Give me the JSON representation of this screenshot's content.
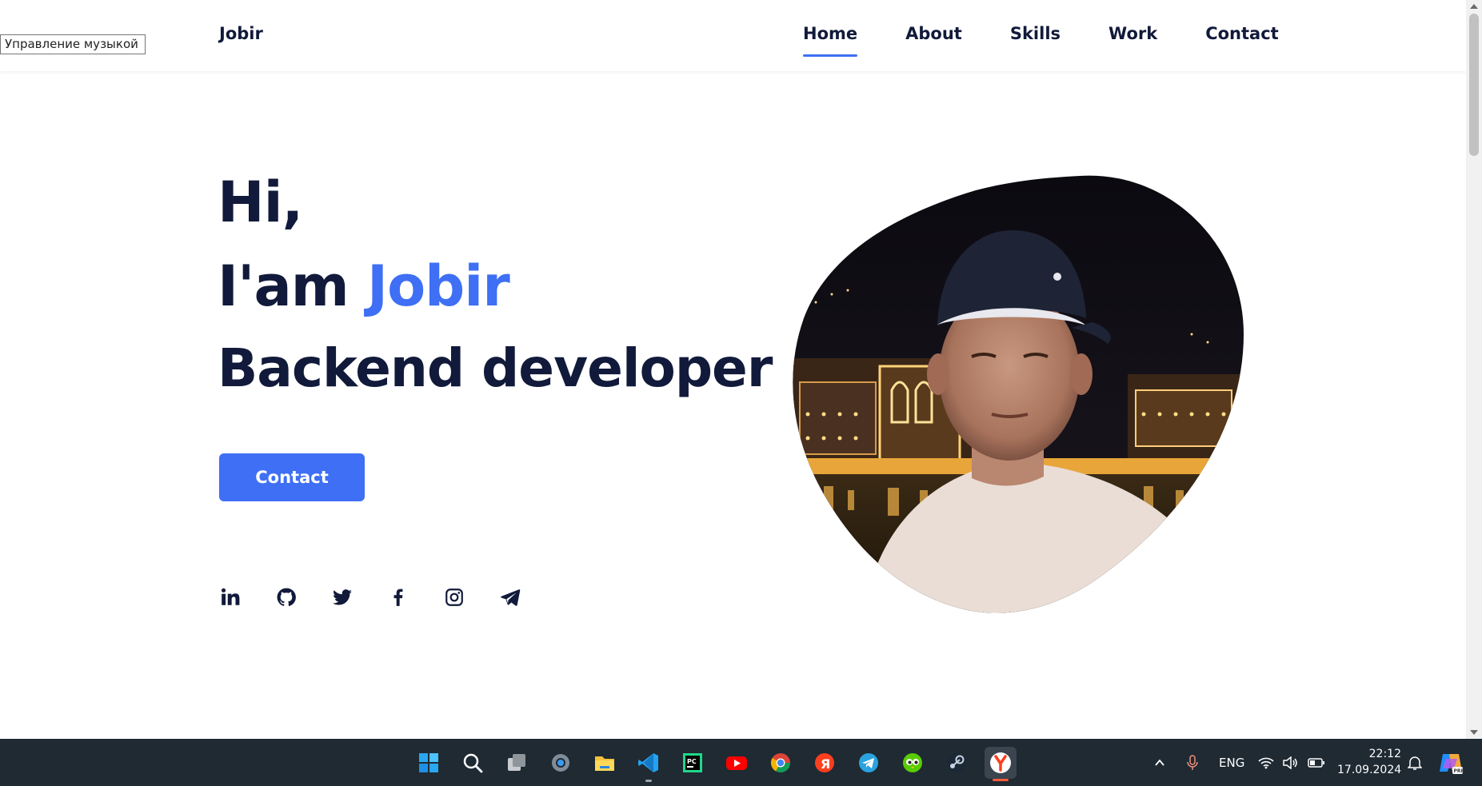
{
  "tooltip": "Управление музыкой",
  "header": {
    "logo": "Jobir",
    "nav": [
      "Home",
      "About",
      "Skills",
      "Work",
      "Contact"
    ],
    "active_nav": "Home"
  },
  "hero": {
    "greeting": "Hi,",
    "intro_prefix": "I'am ",
    "name": "Jobir",
    "role": "Backend developer",
    "cta_label": "Contact",
    "socials": [
      "linkedin-icon",
      "github-icon",
      "twitter-icon",
      "facebook-icon",
      "instagram-icon",
      "telegram-icon"
    ]
  },
  "colors": {
    "accent": "#3e6ff4",
    "text_dark": "#111a3a",
    "taskbar": "#1f2a33"
  },
  "taskbar": {
    "apps": [
      "windows-start-icon",
      "search-icon",
      "task-view-icon",
      "settings-icon",
      "file-explorer-icon",
      "vscode-icon",
      "pycharm-icon",
      "youtube-icon",
      "chrome-icon",
      "yandex-icon",
      "telegram-icon",
      "duolingo-icon",
      "steam-icon",
      "yandex-browser-icon"
    ],
    "language": "ENG",
    "time": "22:12",
    "date": "17.09.2024"
  }
}
